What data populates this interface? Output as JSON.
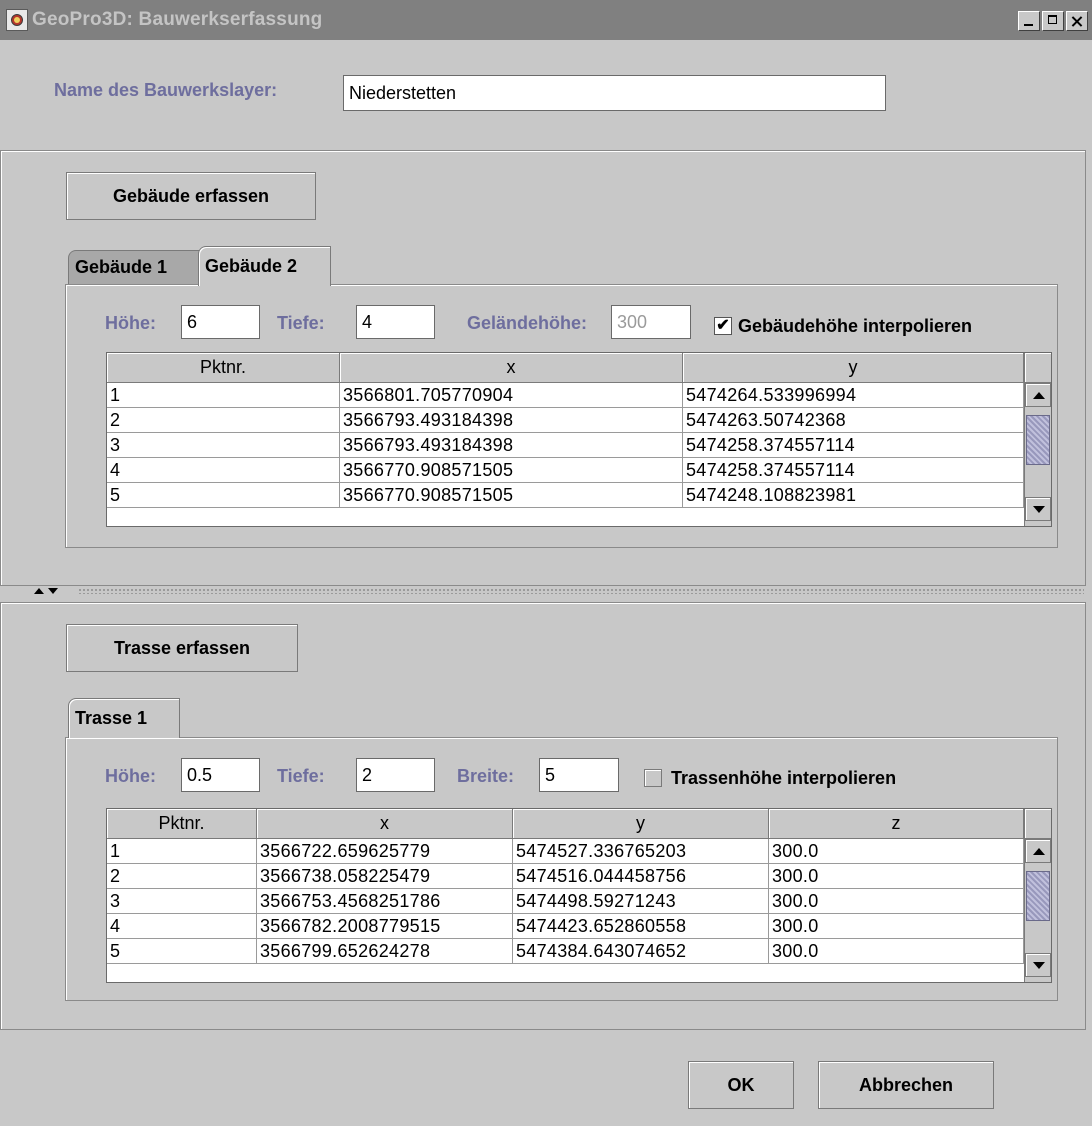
{
  "window": {
    "title": "GeoPro3D: Bauwerkserfassung"
  },
  "layer": {
    "label": "Name des Bauwerkslayer:",
    "value": "Niederstetten"
  },
  "buildings": {
    "capture_button": "Gebäude erfassen",
    "tabs": [
      "Gebäude 1",
      "Gebäude 2"
    ],
    "active_tab": "Gebäude 2",
    "hoehe_label": "Höhe:",
    "hoehe_value": "6",
    "tiefe_label": "Tiefe:",
    "tiefe_value": "4",
    "gelaende_label": "Geländehöhe:",
    "gelaende_value": "300",
    "interpolate_label": "Gebäudehöhe interpolieren",
    "interpolate_checked": true,
    "table": {
      "columns": [
        "Pktnr.",
        "x",
        "y"
      ],
      "rows": [
        [
          "1",
          "3566801.705770904",
          "5474264.533996994"
        ],
        [
          "2",
          "3566793.493184398",
          "5474263.50742368"
        ],
        [
          "3",
          "3566793.493184398",
          "5474258.374557114"
        ],
        [
          "4",
          "3566770.908571505",
          "5474258.374557114"
        ],
        [
          "5",
          "3566770.908571505",
          "5474248.108823981"
        ]
      ]
    }
  },
  "routes": {
    "capture_button": "Trasse erfassen",
    "tabs": [
      "Trasse 1"
    ],
    "active_tab": "Trasse 1",
    "hoehe_label": "Höhe:",
    "hoehe_value": "0.5",
    "tiefe_label": "Tiefe:",
    "tiefe_value": "2",
    "breite_label": "Breite:",
    "breite_value": "5",
    "interpolate_label": "Trassenhöhe interpolieren",
    "interpolate_checked": false,
    "table": {
      "columns": [
        "Pktnr.",
        "x",
        "y",
        "z"
      ],
      "rows": [
        [
          "1",
          "3566722.659625779",
          "5474527.336765203",
          "300.0"
        ],
        [
          "2",
          "3566738.058225479",
          "5474516.044458756",
          "300.0"
        ],
        [
          "3",
          "3566753.4568251786",
          "5474498.59271243",
          "300.0"
        ],
        [
          "4",
          "3566782.2008779515",
          "5474423.652860558",
          "300.0"
        ],
        [
          "5",
          "3566799.652624278",
          "5474384.643074652",
          "300.0"
        ]
      ]
    }
  },
  "footer": {
    "ok_label": "OK",
    "cancel_label": "Abbrechen"
  }
}
